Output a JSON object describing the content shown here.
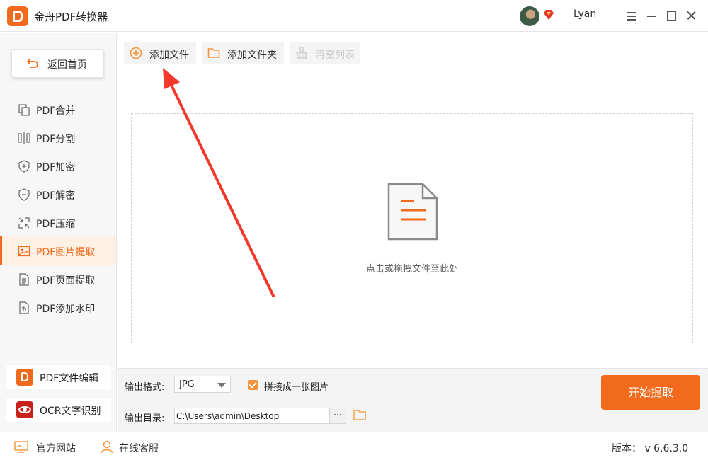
{
  "app": {
    "title": "金舟PDF转换器",
    "username": "Lyan",
    "accent": "#f26a1b"
  },
  "sidebar": {
    "home_label": "返回首页",
    "items": [
      {
        "label": "PDF合并",
        "icon": "merge-icon"
      },
      {
        "label": "PDF分割",
        "icon": "split-icon"
      },
      {
        "label": "PDF加密",
        "icon": "shield-plus-icon"
      },
      {
        "label": "PDF解密",
        "icon": "shield-minus-icon"
      },
      {
        "label": "PDF压缩",
        "icon": "compress-icon"
      },
      {
        "label": "PDF图片提取",
        "icon": "image-icon",
        "active": true
      },
      {
        "label": "PDF页面提取",
        "icon": "page-icon"
      },
      {
        "label": "PDF添加水印",
        "icon": "watermark-icon"
      }
    ],
    "tools": [
      {
        "label": "PDF文件编辑",
        "icon": "pdf-editor-icon"
      },
      {
        "label": "OCR文字识别",
        "icon": "ocr-eye-icon"
      }
    ]
  },
  "toolbar": {
    "add_file": "添加文件",
    "add_folder": "添加文件夹",
    "clear_list": "清空列表"
  },
  "dropzone": {
    "hint": "点击或拖拽文件至此处"
  },
  "settings": {
    "format_label": "输出格式:",
    "format_value": "JPG",
    "merge_label": "拼接成一张图片",
    "merge_checked": true,
    "dir_label": "输出目录:",
    "dir_value": "C:\\Users\\admin\\Desktop",
    "browse_label": "···",
    "start_label": "开始提取"
  },
  "status": {
    "website": "官方网站",
    "support": "在线客服",
    "version": "版本：  v 6.6.3.0"
  }
}
